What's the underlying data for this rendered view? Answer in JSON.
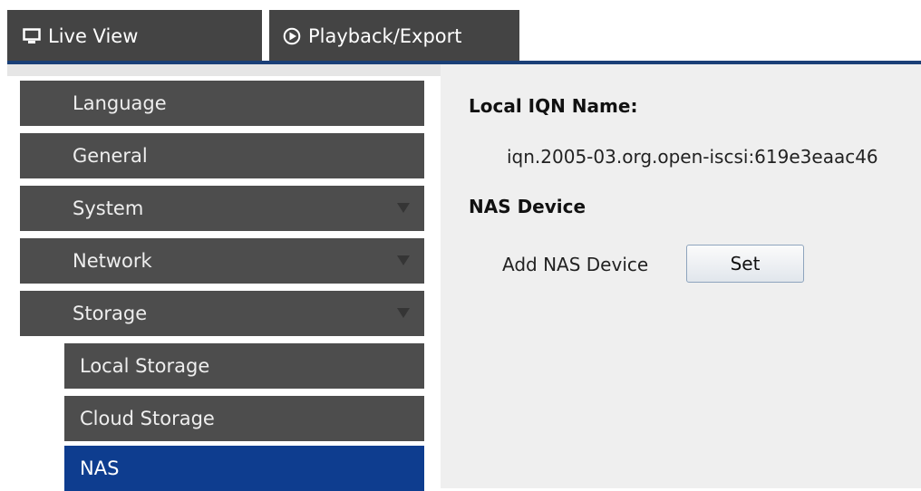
{
  "tabs": [
    {
      "label": "Live View",
      "icon": "monitor-icon"
    },
    {
      "label": "Playback/Export",
      "icon": "play-circle-icon"
    }
  ],
  "sidebar": {
    "items": [
      {
        "label": "Language"
      },
      {
        "label": "General"
      },
      {
        "label": "System",
        "expandable": true
      },
      {
        "label": "Network",
        "expandable": true
      },
      {
        "label": "Storage",
        "expandable": true,
        "expanded": true
      },
      {
        "label": "Local Storage",
        "sub": true
      },
      {
        "label": "Cloud Storage",
        "sub": true
      },
      {
        "label": "NAS",
        "sub": true,
        "selected": true
      }
    ]
  },
  "main": {
    "iqn_label": "Local IQN Name:",
    "iqn_value": "iqn.2005-03.org.open-iscsi:619e3eaac46",
    "nas_section_title": "NAS Device",
    "add_nas_label": "Add NAS Device",
    "set_button_label": "Set"
  },
  "colors": {
    "tab_bg": "#444444",
    "nav_bg": "#4d4d4d",
    "nav_active": "#0e3d8f",
    "accent_line": "#1a3f77",
    "content_bg": "#efefef"
  }
}
